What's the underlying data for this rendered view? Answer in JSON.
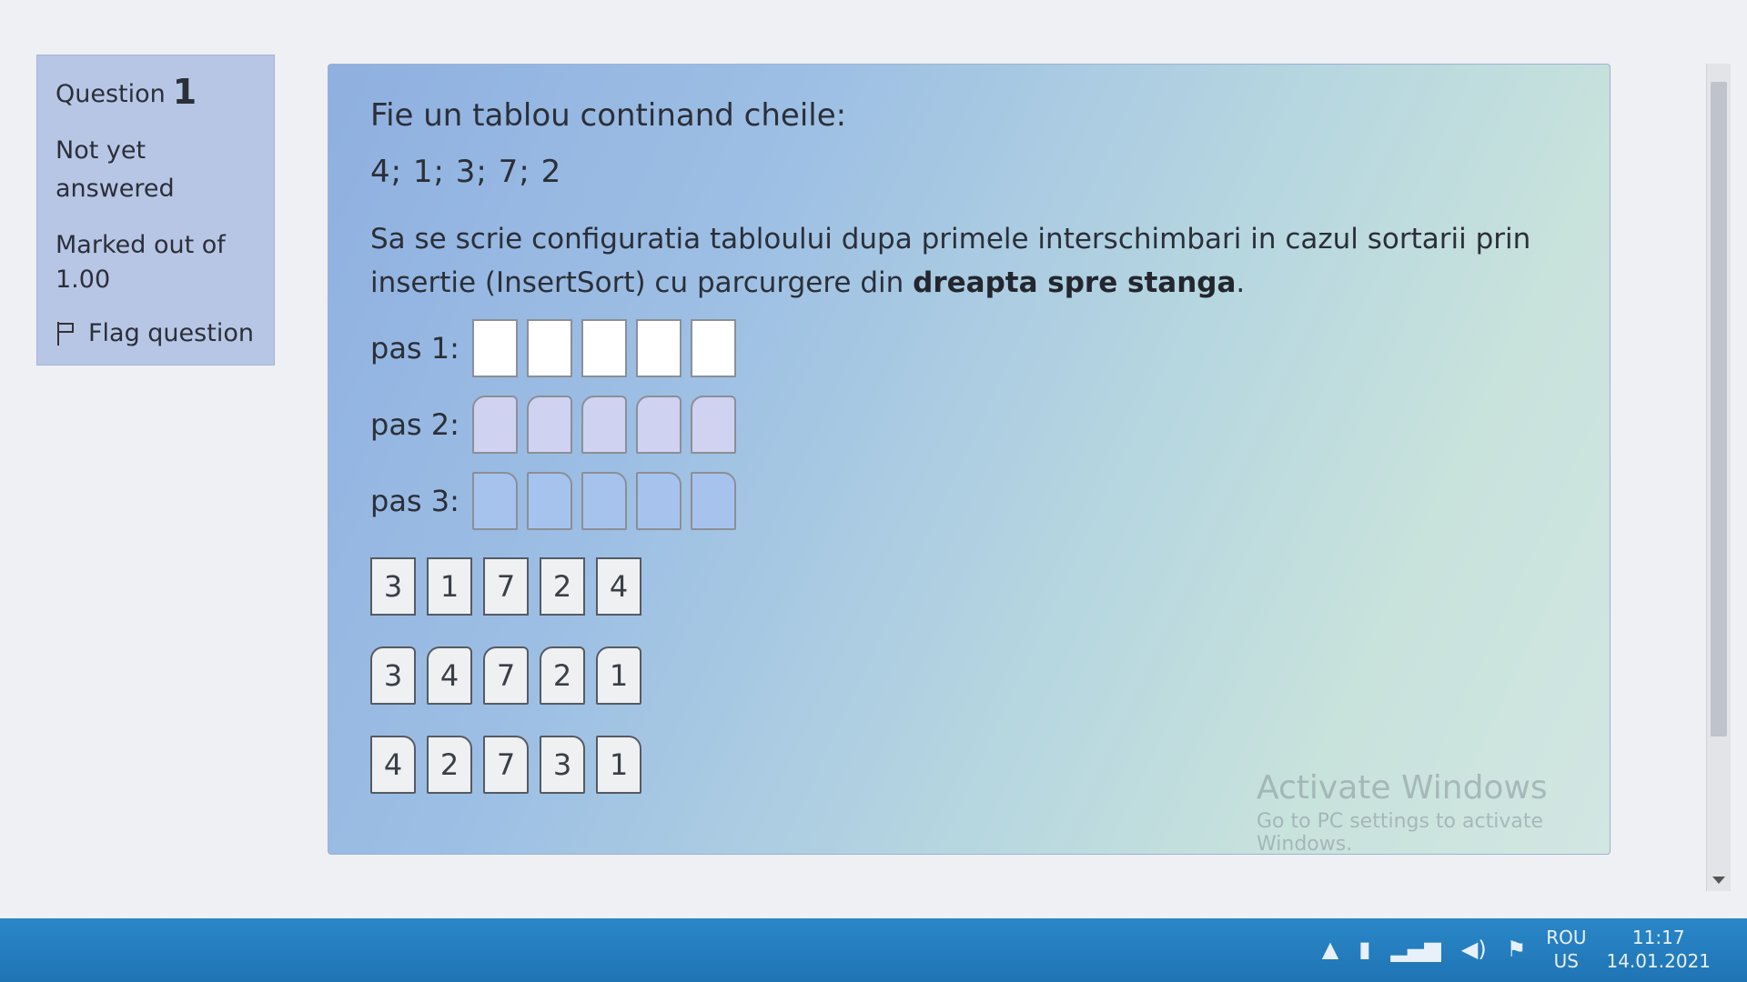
{
  "question_info": {
    "label": "Question",
    "number": "1",
    "status": "Not yet answered",
    "marked": "Marked out of 1.00",
    "flag_label": "Flag question"
  },
  "question": {
    "intro": "Fie un tablou continand cheile:",
    "keys": "4; 1; 3; 7; 2",
    "instruction_start": "Sa se scrie configuratia tabloului dupa primele interschimbari in cazul sortarii prin insertie (InsertSort) cu parcurgere din ",
    "instruction_bold": "dreapta spre stanga",
    "instruction_end": ".",
    "steps": [
      {
        "label": "pas 1:"
      },
      {
        "label": "pas 2:"
      },
      {
        "label": "pas 3:"
      }
    ],
    "choices": [
      [
        "3",
        "1",
        "7",
        "2",
        "4"
      ],
      [
        "3",
        "4",
        "7",
        "2",
        "1"
      ],
      [
        "4",
        "2",
        "7",
        "3",
        "1"
      ]
    ]
  },
  "watermark": {
    "line1": "Activate Windows",
    "line2": "Go to PC settings to activate Windows."
  },
  "taskbar": {
    "lang_top": "ROU",
    "lang_bottom": "US",
    "time": "11:17",
    "date": "14.01.2021",
    "icons": [
      "show-hidden-icons-icon",
      "battery-icon",
      "signal-icon",
      "volume-icon",
      "action-center-flag-icon"
    ]
  }
}
